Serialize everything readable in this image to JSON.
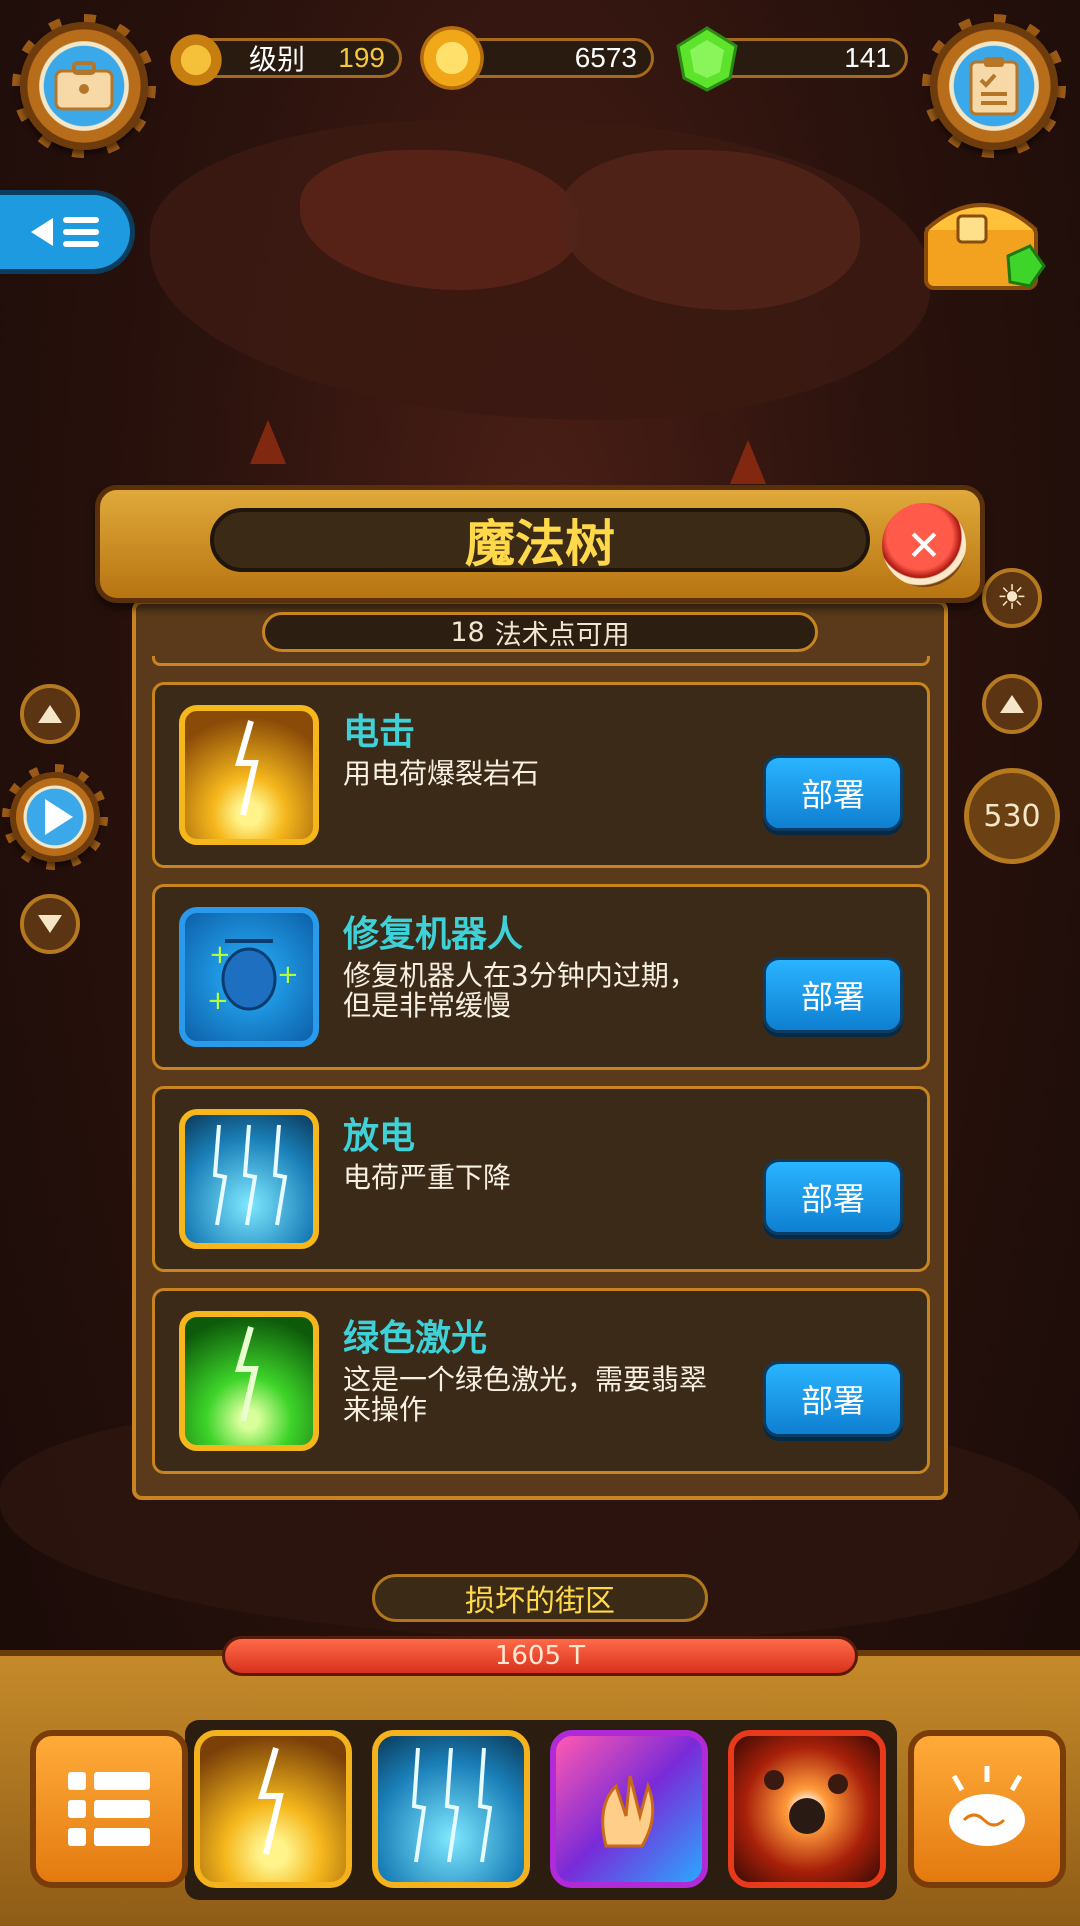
{
  "hud": {
    "level_label": "级别",
    "level_value": "199",
    "coins": "6573",
    "gems": "141"
  },
  "panel": {
    "title": "魔法树",
    "points_value": "18",
    "points_label": "法术点可用"
  },
  "side": {
    "depth_value": "530"
  },
  "spells": [
    {
      "name": "电击",
      "desc": "用电荷爆裂岩石",
      "button": "部署"
    },
    {
      "name": "修复机器人",
      "desc": "修复机器人在3分钟内过期，但是非常缓慢",
      "button": "部署"
    },
    {
      "name": "放电",
      "desc": "电荷严重下降",
      "button": "部署"
    },
    {
      "name": "绿色激光",
      "desc": "这是一个绿色激光，需要翡翠来操作",
      "button": "部署"
    }
  ],
  "bottom": {
    "district": "损坏的街区",
    "hp_text": "1605 T"
  },
  "colors": {
    "accent_gold": "#c8841e",
    "title_yellow": "#ffd94a",
    "spell_name_cyan": "#3fd1d8",
    "deploy_blue": "#1d9cf0",
    "hp_red": "#e8432a"
  },
  "icons": {
    "top_left": "briefcase-icon",
    "top_right": "clipboard-icon",
    "chest": "treasure-chest-icon",
    "sun": "sun-icon",
    "dock_menu": "list-menu-icon",
    "dock_brain": "brain-icon"
  }
}
